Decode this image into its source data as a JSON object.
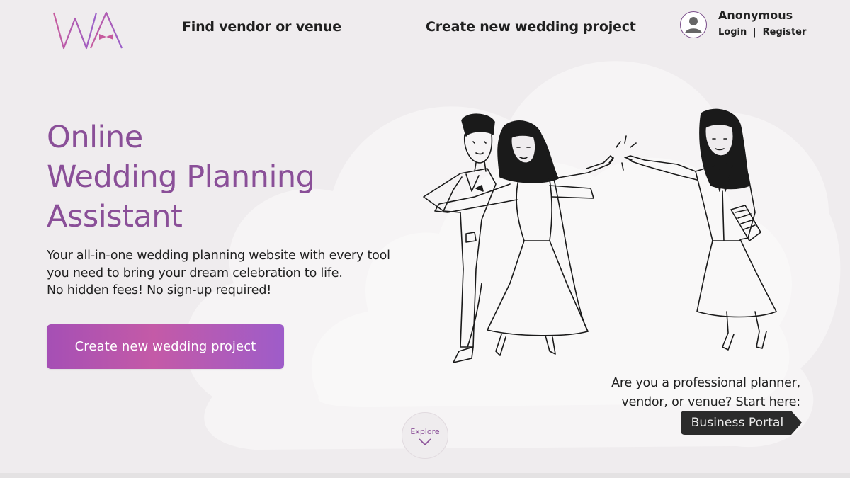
{
  "header": {
    "logo_text": "WA",
    "nav": {
      "find_vendor": "Find vendor or venue",
      "create_project": "Create new wedding project"
    },
    "user": {
      "name": "Anonymous",
      "login": "Login",
      "separator": "|",
      "register": "Register",
      "avatar_icon": "user-avatar-icon"
    }
  },
  "hero": {
    "title_lines": [
      "Online",
      "Wedding Planning",
      "Assistant"
    ],
    "description_lines": [
      "Your all-in-one wedding planning website with every tool",
      "you need to bring your dream celebration to life.",
      "No hidden fees! No sign-up required!"
    ],
    "cta_label": "Create new wedding project"
  },
  "professional": {
    "line1": "Are you a professional planner,",
    "line2": "vendor, or venue? Start here:",
    "portal_label": "Business Portal"
  },
  "explore": {
    "label": "Explore",
    "icon": "chevron-down-icon"
  },
  "colors": {
    "background": "#efecee",
    "accent_purple": "#8a4f98",
    "button_gradient_start": "#a54fb5",
    "button_gradient_end": "#9e5cc9",
    "portal_dark": "#2b2b2b"
  }
}
